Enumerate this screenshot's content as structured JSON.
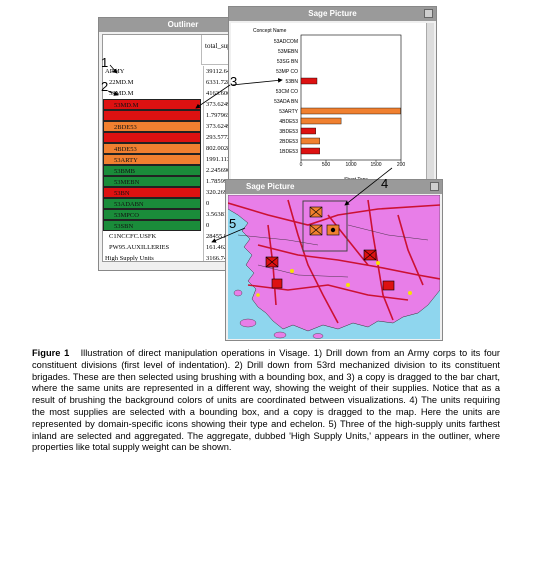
{
  "outliner": {
    "title": "Outliner",
    "column_header": "total_supply_weig",
    "rows": [
      {
        "name": "ARMY",
        "value": "39112.641",
        "bg": "#ffffff",
        "indent": 0
      },
      {
        "name": "22MD.M",
        "value": "6331.7285",
        "bg": "#ffffff",
        "indent": 4
      },
      {
        "name": "53MD.M",
        "value": "4163.6064",
        "bg": "#ffffff",
        "indent": 4
      },
      {
        "name": "53MD.M",
        "value": "373.62494",
        "bg": "#dd1111",
        "indent": 8
      },
      {
        "name": "",
        "value": "1.7979659",
        "bg": "#dd1111",
        "indent": 8
      },
      {
        "name": "2BDE53",
        "value": "373.62494",
        "bg": "#f08030",
        "indent": 8
      },
      {
        "name": "",
        "value": "293.57724",
        "bg": "#dd1111",
        "indent": 8
      },
      {
        "name": "4BDE53",
        "value": "802.00289",
        "bg": "#f08030",
        "indent": 8
      },
      {
        "name": "53ARTY",
        "value": "1991.1132",
        "bg": "#f08030",
        "indent": 8
      },
      {
        "name": "53BMB",
        "value": "2.2456901",
        "bg": "#1a8c3a",
        "indent": 8
      },
      {
        "name": "53MEBN",
        "value": "1.7859901",
        "bg": "#1a8c3a",
        "indent": 8
      },
      {
        "name": "53BN",
        "value": "320.26987",
        "bg": "#dd1111",
        "indent": 8
      },
      {
        "name": "53ADABN",
        "value": "0",
        "bg": "#1a8c3a",
        "indent": 8
      },
      {
        "name": "53MPCO",
        "value": "3.5638185",
        "bg": "#1a8c3a",
        "indent": 8
      },
      {
        "name": "53SBN",
        "value": "0",
        "bg": "#1a8c3a",
        "indent": 8
      },
      {
        "name": "C1NCCFC.USFK",
        "value": "28455.8",
        "bg": "#ffffff",
        "indent": 4
      },
      {
        "name": "PW95.AUXILLERIES",
        "value": "161.4626",
        "bg": "#ffffff",
        "indent": 4
      },
      {
        "name": "High Supply Units",
        "value": "3166.74",
        "bg": "#ffffff",
        "indent": 0
      }
    ]
  },
  "sage_chart": {
    "title": "Sage Picture",
    "legend_header": "Concept Name",
    "axis_label": "Short Tons"
  },
  "chart_data": {
    "type": "bar",
    "orientation": "horizontal",
    "categories": [
      "53ADCOM",
      "53MEBN",
      "53SG BN",
      "53MP CO",
      "53BN",
      "53CM CO",
      "53ADA BN",
      "53ARTY",
      "4BDE53",
      "3BDE53",
      "2BDE53",
      "1BDE53"
    ],
    "values": [
      0,
      0,
      0,
      0,
      320,
      0,
      0,
      1991,
      802,
      294,
      374,
      374
    ],
    "xlabel": "Short Tons",
    "xlim": [
      0,
      2000
    ],
    "xticks": [
      "0",
      "500",
      "1000",
      "1500",
      "200"
    ]
  },
  "sage_map": {
    "title": "Sage Picture"
  },
  "callouts": [
    "1",
    "2",
    "3",
    "4",
    "5"
  ],
  "caption": {
    "label": "Figure 1",
    "text": "Illustration of direct manipulation operations in Visage.  1) Drill down from an Army corps to its four constituent divisions (first level of indentation).  2) Drill down from 53rd mechanized division to its constituent brigades.  These are then selected using brushing with a bounding box, and 3) a copy is dragged to the bar chart, where the same units are represented in a different way, showing the weight of their supplies.  Notice that as a result of brushing the background colors of units are coordinated between visualizations.  4) The units requiring the most supplies are selected with a bounding box, and a copy is dragged to the map.  Here the units are represented by domain-specific icons showing their type and echelon.  5) Three of the high-supply units farthest inland are selected and aggregated.  The aggregate, dubbed 'High Supply Units,' appears in the outliner, where properties like total supply weight can be shown."
  },
  "colors": {
    "red": "#dd1111",
    "orange": "#f08030",
    "green": "#1a8c3a",
    "map_land": "#e87ee8",
    "map_sea": "#8fd6ee",
    "road": "#cc1133"
  }
}
